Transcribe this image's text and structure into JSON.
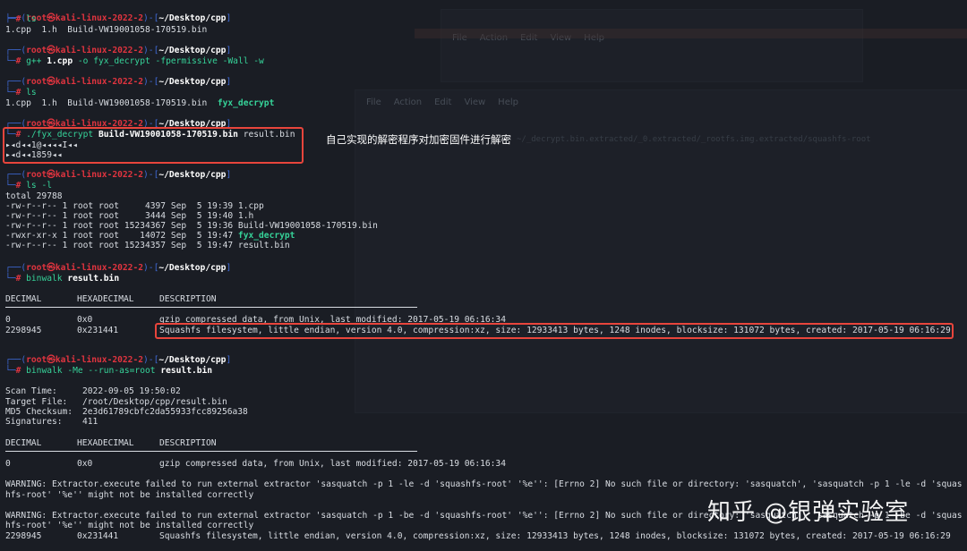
{
  "bg_menu_1": [
    "File",
    "Action",
    "Edit",
    "View",
    "Help"
  ],
  "bg_menu_2": [
    "File",
    "Action",
    "Edit",
    "View",
    "Help"
  ],
  "bg_path": "~/_decrypt.bin.extracted/_0.extracted/_rootfs.img.extracted/squashfs-root",
  "prompt": {
    "user": "root",
    "at": "㉿",
    "host": "kali-linux-2022-2",
    "path": "~/Desktop/cpp"
  },
  "blocks": [
    {
      "cmd": "ls",
      "out": [
        "1.cpp  1.h  Build-VW19001058-170519.bin"
      ]
    },
    {
      "cmd_parts": [
        "g++ ",
        "1.cpp",
        " -o fyx_decrypt -fpermissive -Wall -w"
      ]
    },
    {
      "cmd": "ls",
      "out_parts": [
        "1.cpp  1.h  Build-VW19001058-170519.bin  ",
        "fyx_decrypt"
      ]
    },
    {
      "cmd_parts": [
        "./fyx_decrypt ",
        "Build-VW19001058-170519.bin",
        " result.bin"
      ],
      "out": [
        "▸◂d◂◂1@◂◂◂◂I◂◂",
        "▸◂d◂◂1859◂◂"
      ]
    },
    {
      "cmd": "ls -l",
      "out": [
        "total 29788",
        "-rw-r--r-- 1 root root     4397 Sep  5 19:39 1.cpp",
        "-rw-r--r-- 1 root root     3444 Sep  5 19:40 1.h",
        "-rw-r--r-- 1 root root 15234367 Sep  5 19:36 Build-VW19001058-170519.bin"
      ],
      "out_exec": [
        "-rwxr-xr-x 1 root root    14072 Sep  5 19:47 ",
        "fyx_decrypt"
      ],
      "out_last": "-rw-r--r-- 1 root root 15234357 Sep  5 19:47 result.bin"
    },
    {
      "cmd_parts": [
        "binwalk ",
        "result.bin"
      ]
    },
    {
      "cmd_parts": [
        "binwalk -Me --run-as=root ",
        "result.bin"
      ]
    }
  ],
  "annotation": "自己实现的解密程序对加密固件进行解密",
  "binwalk1": {
    "headers": [
      "DECIMAL",
      "HEXADECIMAL",
      "DESCRIPTION"
    ],
    "rows": [
      [
        "0",
        "0x0",
        "gzip compressed data, from Unix, last modified: 2017-05-19 06:16:34"
      ],
      [
        "2298945",
        "0x231441",
        "Squashfs filesystem, little endian, version 4.0, compression:xz, size: 12933413 bytes, 1248 inodes, blocksize: 131072 bytes, created: 2017-05-19 06:16:29"
      ]
    ]
  },
  "scan": {
    "time_label": "Scan Time:",
    "time": "2022-09-05 19:50:02",
    "file_label": "Target File:",
    "file": "/root/Desktop/cpp/result.bin",
    "md5_label": "MD5 Checksum:",
    "md5": "2e3d61789cbfc2da55933fcc89256a38",
    "sig_label": "Signatures:",
    "sig": "411"
  },
  "binwalk2": {
    "headers": [
      "DECIMAL",
      "HEXADECIMAL",
      "DESCRIPTION"
    ],
    "rows": [
      [
        "0",
        "0x0",
        "gzip compressed data, from Unix, last modified: 2017-05-19 06:16:34"
      ]
    ]
  },
  "warnings": [
    "WARNING: Extractor.execute failed to run external extractor 'sasquatch -p 1 -le -d 'squashfs-root' '%e'': [Errno 2] No such file or directory: 'sasquatch', 'sasquatch -p 1 -le -d 'squas",
    "hfs-root' '%e'' might not be installed correctly",
    "WARNING: Extractor.execute failed to run external extractor 'sasquatch -p 1 -be -d 'squashfs-root' '%e'': [Errno 2] No such file or directory: 'sasquatch', 'sasquatch -p 1 -be -d 'squas",
    "hfs-root' '%e'' might not be installed correctly"
  ],
  "last_row": [
    "2298945",
    "0x231441",
    "Squashfs filesystem, little endian, version 4.0, compression:xz, size: 12933413 bytes, 1248 inodes, blocksize: 131072 bytes, created: 2017-05-19 06:16:29"
  ],
  "watermark": "知乎 @银弹实验室"
}
